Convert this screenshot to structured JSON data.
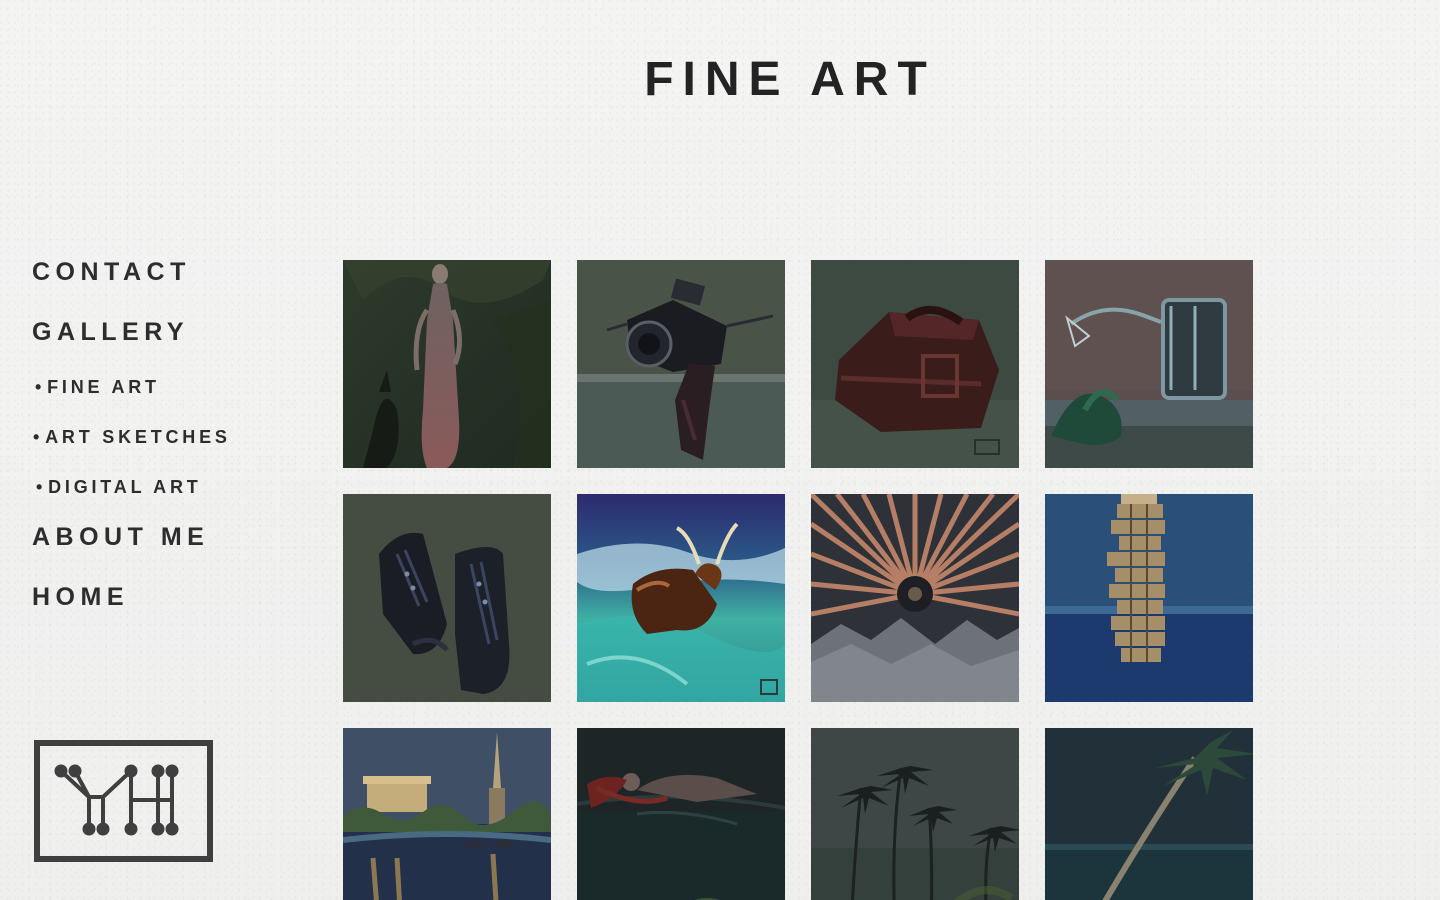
{
  "page": {
    "title": "FINE ART"
  },
  "nav": {
    "items": [
      {
        "label": "CONTACT"
      },
      {
        "label": "GALLERY"
      },
      {
        "label": "FINE ART"
      },
      {
        "label": "ART SKETCHES"
      },
      {
        "label": "DIGITAL ART"
      },
      {
        "label": "ABOUT ME"
      },
      {
        "label": "HOME"
      }
    ],
    "bullet": "•"
  },
  "logo": {
    "icon": "yh-monogram-logo"
  },
  "gallery": {
    "artworks": [
      {
        "icon": "painting-woman-with-dog"
      },
      {
        "icon": "painting-camera"
      },
      {
        "icon": "painting-leather-bag"
      },
      {
        "icon": "painting-hand-mixer"
      },
      {
        "icon": "painting-boots"
      },
      {
        "icon": "painting-bull-in-river"
      },
      {
        "icon": "painting-radial-rays"
      },
      {
        "icon": "painting-block-tower"
      },
      {
        "icon": "painting-monument-reflection"
      },
      {
        "icon": "painting-woman-in-water"
      },
      {
        "icon": "painting-palm-trees-fog"
      },
      {
        "icon": "painting-palm-tree-night"
      }
    ]
  },
  "colors": {
    "background": "#f1f1f0",
    "text": "#2d2d2d",
    "logo_stroke": "#3f3f3f"
  }
}
